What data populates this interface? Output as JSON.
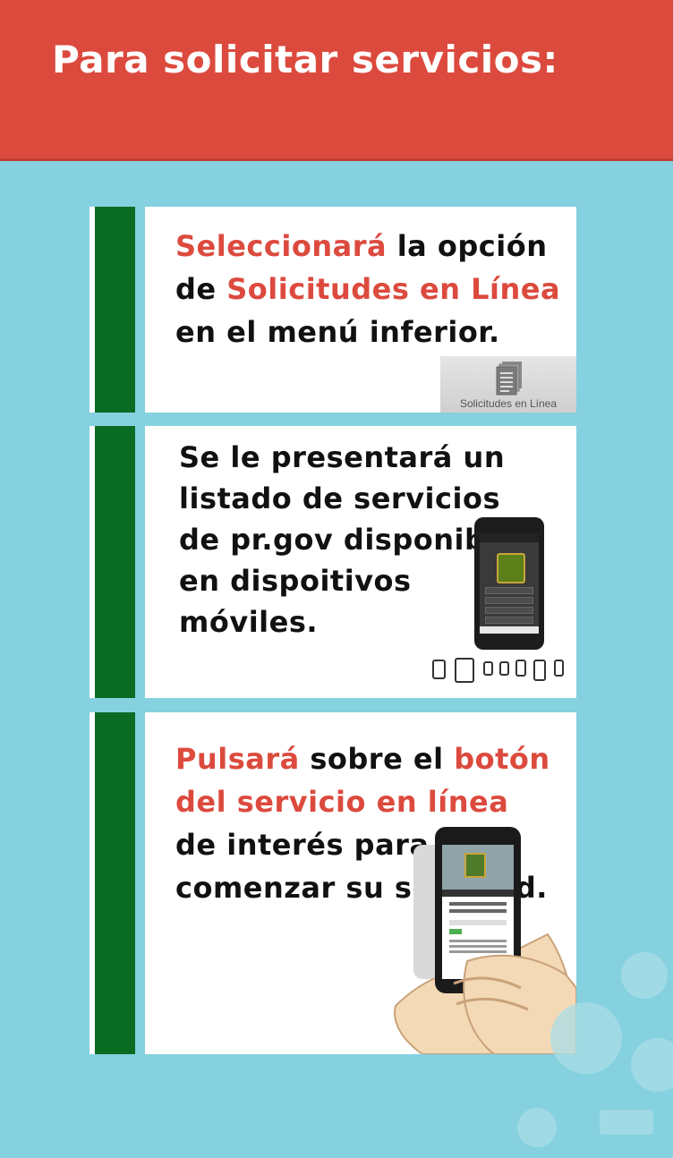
{
  "header": {
    "title": "Para solicitar servicios:"
  },
  "steps": [
    {
      "segments": [
        {
          "text": "Seleccionará",
          "highlight": true
        },
        {
          "text": " la opción de ",
          "highlight": false
        },
        {
          "text": "Solicitudes en Línea",
          "highlight": true
        },
        {
          "text": " en el menú inferior.",
          "highlight": false
        }
      ],
      "button": {
        "icon": "document-stack-icon",
        "label": "Solicitudes en Línea"
      }
    },
    {
      "segments": [
        {
          "text": "Se le presentará un listado de servicios de pr.gov disponibles en dispoitivos móviles.",
          "highlight": false
        }
      ],
      "illustration": {
        "icon": "smartphone-icon",
        "devices_icon": "devices-row-icon"
      }
    },
    {
      "segments": [
        {
          "text": "Pulsará",
          "highlight": true
        },
        {
          "text": " sobre el ",
          "highlight": false
        },
        {
          "text": "botón del servicio en línea",
          "highlight": true
        },
        {
          "text": " de interés para comenzar su solicitud.",
          "highlight": false
        }
      ],
      "illustration": {
        "icon": "hand-holding-phone-icon"
      }
    }
  ],
  "colors": {
    "header": "#dc4a3e",
    "background": "#85d1df",
    "accent_bar": "#0a6b22",
    "highlight_text": "#dc4a3e",
    "body_text": "#111111"
  }
}
